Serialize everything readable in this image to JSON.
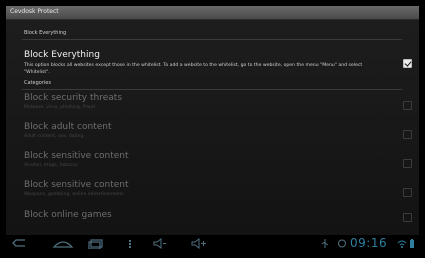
{
  "window": {
    "title": "Cevdosk Protect"
  },
  "master": {
    "section_title": "Block Everything",
    "label": "Block Everything",
    "description": "This option blocks all websites except those in the whitelist. To add a website to the whitelist, go to the website, open the menu \"Menu\" and select \"Whitelist\".",
    "checked": true
  },
  "categories": {
    "section_title": "Categories",
    "items": [
      {
        "label": "Block security threats",
        "sub": "Malware, virus, phishing, fraud",
        "checked": false
      },
      {
        "label": "Block adult content",
        "sub": "Adult content, sex, dating",
        "checked": false
      },
      {
        "label": "Block sensitive content",
        "sub": "Alcohol, drugs, tobacco",
        "checked": false
      },
      {
        "label": "Block sensitive content",
        "sub": "Weapons, gambling, online advertisements",
        "checked": false
      },
      {
        "label": "Block online games",
        "sub": "",
        "checked": false
      }
    ]
  },
  "navbar": {
    "buttons": [
      "back-icon",
      "home-icon",
      "recent-apps-icon",
      "menu-icon",
      "volume-down-icon",
      "volume-up-icon"
    ],
    "status_icons": [
      "usb-icon",
      "sync-icon",
      "wifi-icon",
      "battery-icon"
    ],
    "time": "09:16",
    "accent_color": "#2f7fa0"
  }
}
